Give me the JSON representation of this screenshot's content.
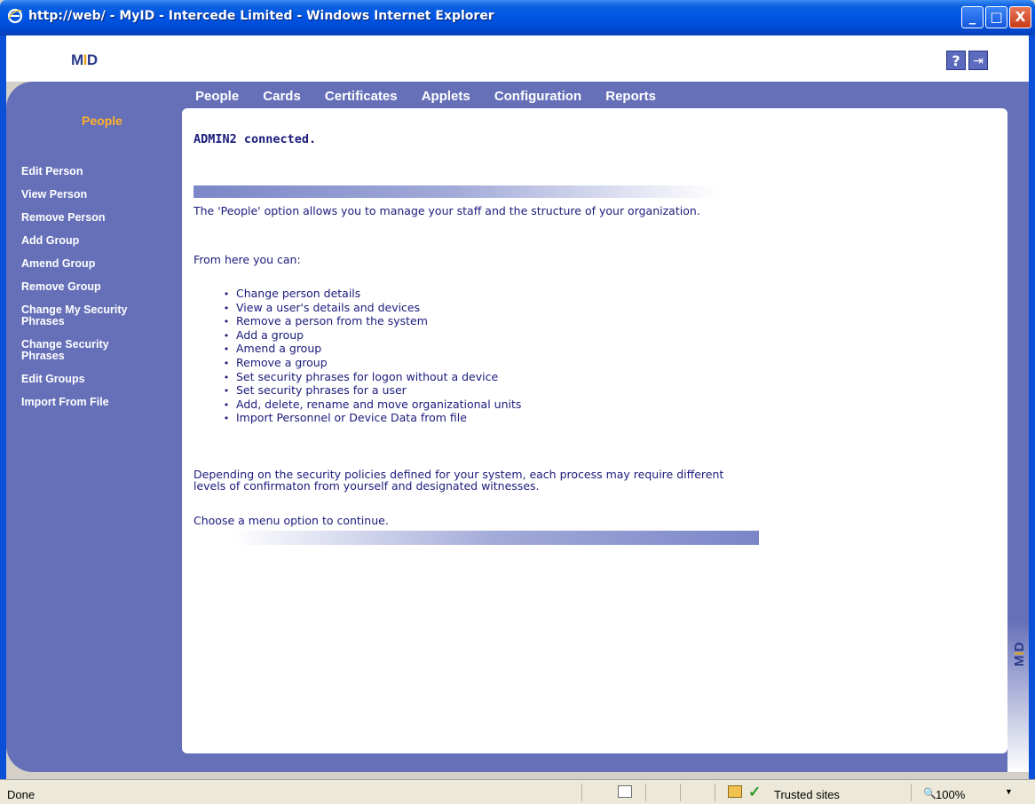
{
  "window": {
    "title": "http://web/ - MyID - Intercede Limited - Windows Internet Explorer",
    "minimize_glyph": "_",
    "maximize_glyph": "□",
    "close_glyph": "X",
    "icons": [
      "ie-icon",
      "minimize-icon",
      "maximize-icon",
      "close-icon"
    ]
  },
  "header": {
    "logo_text_left": "M",
    "logo_text_accent": "I",
    "logo_text_right": "D",
    "help_glyph": "?",
    "exit_glyph": "⇥"
  },
  "topnav": {
    "items": [
      "People",
      "Cards",
      "Certificates",
      "Applets",
      "Configuration",
      "Reports"
    ]
  },
  "sidebar": {
    "title": "People",
    "items": [
      "Edit Person",
      "View Person",
      "Remove Person",
      "Add Group",
      "Amend Group",
      "Remove Group",
      "Change My Security Phrases",
      "Change Security Phrases",
      "Edit Groups",
      "Import From File"
    ]
  },
  "content": {
    "connected": "ADMIN2 connected.",
    "intro": "The 'People' option allows you to manage your staff and the structure of your organization.",
    "from_here": "From here you can:",
    "bullets": [
      "Change person details",
      "View a user's details and devices",
      "Remove a person from the system",
      "Add a group",
      "Amend a group",
      "Remove a group",
      "Set security phrases for logon without a device",
      "Set security phrases for a user",
      "Add, delete, rename and move organizational units",
      "Import Personnel or Device Data from file"
    ],
    "depending": "Depending on the security policies defined for your system, each process may require different levels of confirmaton from yourself and designated witnesses.",
    "choose": "Choose a menu option to continue."
  },
  "statusbar": {
    "status": "Done",
    "zone": "Trusted sites",
    "zoom": "100%",
    "check_glyph": "✓",
    "zoom_glyph": "🔍",
    "arrow_glyph": "▼"
  },
  "colors": {
    "app_purple": "#6670b8",
    "sidebar_title": "#ffb02a",
    "content_text": "#1a1a7c"
  }
}
